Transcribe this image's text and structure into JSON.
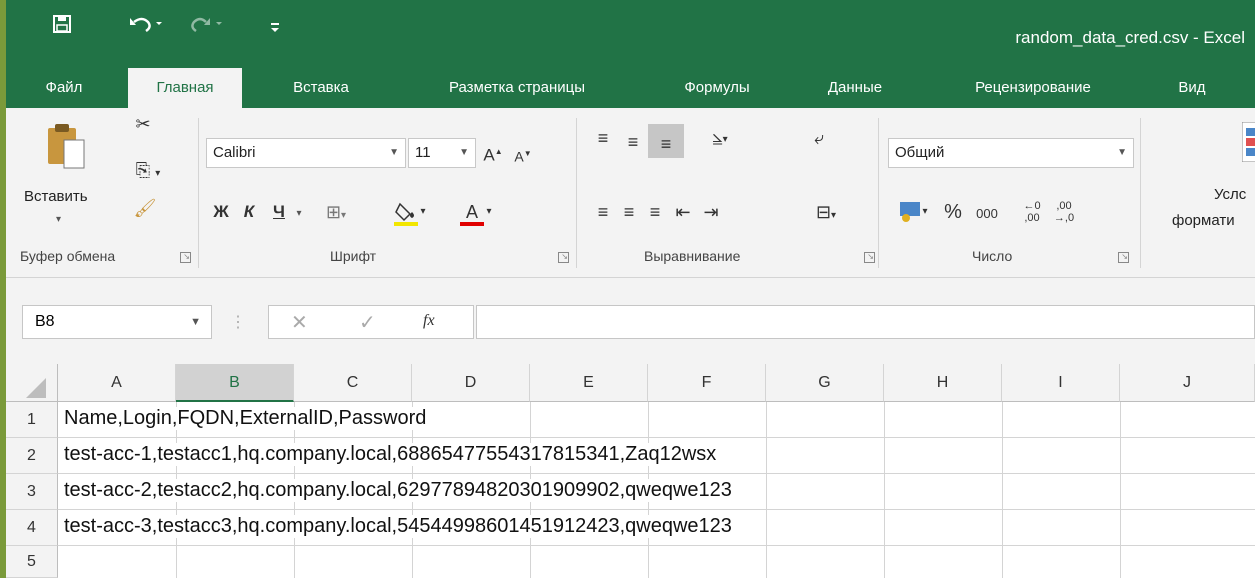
{
  "window": {
    "title": "random_data_cred.csv - Excel"
  },
  "qat": {
    "save_icon": "save-icon",
    "undo_icon": "undo-icon",
    "redo_icon": "redo-icon",
    "customize_icon": "customize-qat-icon"
  },
  "tabs": [
    {
      "label": "Файл"
    },
    {
      "label": "Главная"
    },
    {
      "label": "Вставка"
    },
    {
      "label": "Разметка страницы"
    },
    {
      "label": "Формулы"
    },
    {
      "label": "Данные"
    },
    {
      "label": "Рецензирование"
    },
    {
      "label": "Вид"
    }
  ],
  "ribbon": {
    "clipboard": {
      "paste_label": "Вставить",
      "group_label": "Буфер обмена"
    },
    "font": {
      "font_name": "Calibri",
      "font_size": "11",
      "bold": "Ж",
      "italic": "К",
      "underline": "Ч",
      "group_label": "Шрифт"
    },
    "alignment": {
      "group_label": "Выравнивание"
    },
    "number": {
      "format": "Общий",
      "percent": "%",
      "thousands": "000",
      "group_label": "Число"
    },
    "styles": {
      "conditional_label_1": "Услс",
      "conditional_label_2": "формати"
    }
  },
  "formula_bar": {
    "name_box": "B8",
    "fx": "fx",
    "formula": ""
  },
  "grid": {
    "columns": [
      "A",
      "B",
      "C",
      "D",
      "E",
      "F",
      "G",
      "H",
      "I",
      "J"
    ],
    "selected_column": "B",
    "rows": [
      {
        "num": "1",
        "a": "Name,Login,FQDN,ExternalID,Password"
      },
      {
        "num": "2",
        "a": "test-acc-1,testacc1,hq.company.local,68865477554317815341,Zaq12wsx"
      },
      {
        "num": "3",
        "a": "test-acc-2,testacc2,hq.company.local,62977894820301909902,qweqwe123"
      },
      {
        "num": "4",
        "a": "test-acc-3,testacc3,hq.company.local,54544998601451912423,qweqwe123"
      },
      {
        "num": "5",
        "a": ""
      }
    ]
  },
  "colors": {
    "accent": "#217346",
    "ribbon_bg": "#f3f3f3"
  }
}
